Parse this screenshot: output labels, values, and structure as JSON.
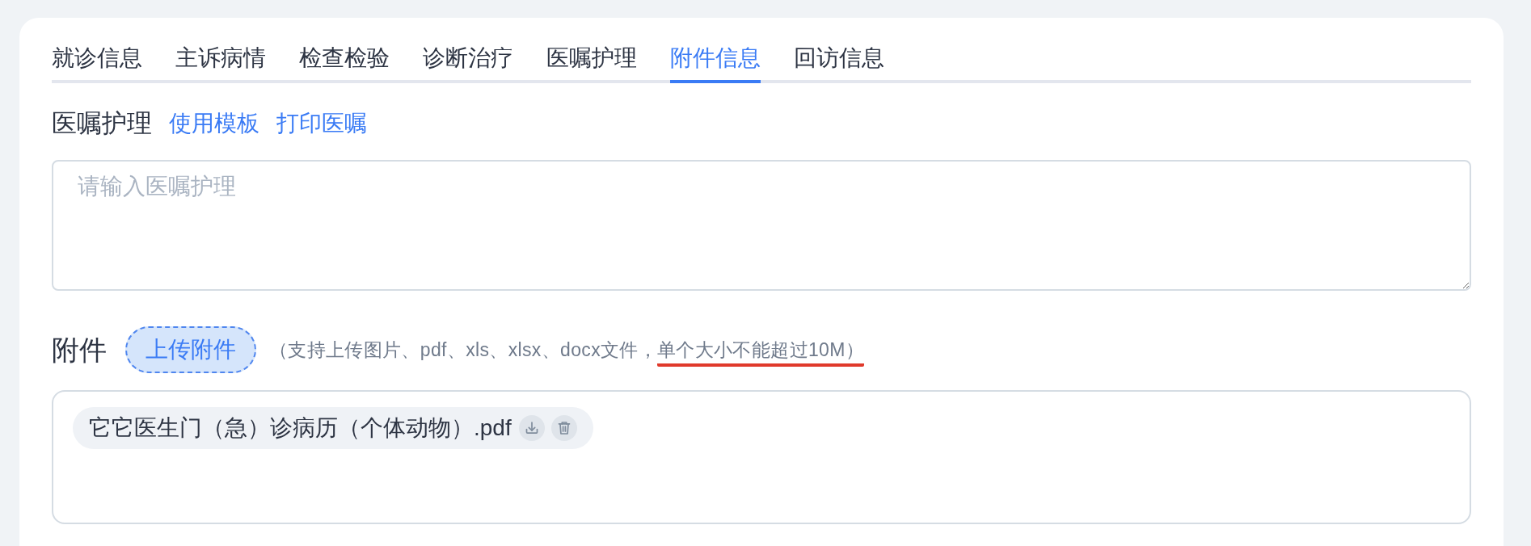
{
  "tabs": [
    {
      "label": "就诊信息",
      "selected": false
    },
    {
      "label": "主诉病情",
      "selected": false
    },
    {
      "label": "检查检验",
      "selected": false
    },
    {
      "label": "诊断治疗",
      "selected": false
    },
    {
      "label": "医嘱护理",
      "selected": false
    },
    {
      "label": "附件信息",
      "selected": true
    },
    {
      "label": "回访信息",
      "selected": false
    }
  ],
  "orders_section": {
    "title": "医嘱护理",
    "links": [
      "使用模板",
      "打印医嘱"
    ],
    "textarea": {
      "placeholder": "请输入医嘱护理"
    }
  },
  "attachments": {
    "label": "附件",
    "upload_button": "上传附件",
    "hint": [
      {
        "text": "（支持上传图片、pdf、xls、xlsx、docx文件，",
        "underlined": false
      },
      {
        "text": "单个大小不能超过10M）",
        "underlined": true
      }
    ],
    "files": [
      {
        "name": "它它医生门（急）诊病历（个体动物）.pdf"
      }
    ]
  }
}
